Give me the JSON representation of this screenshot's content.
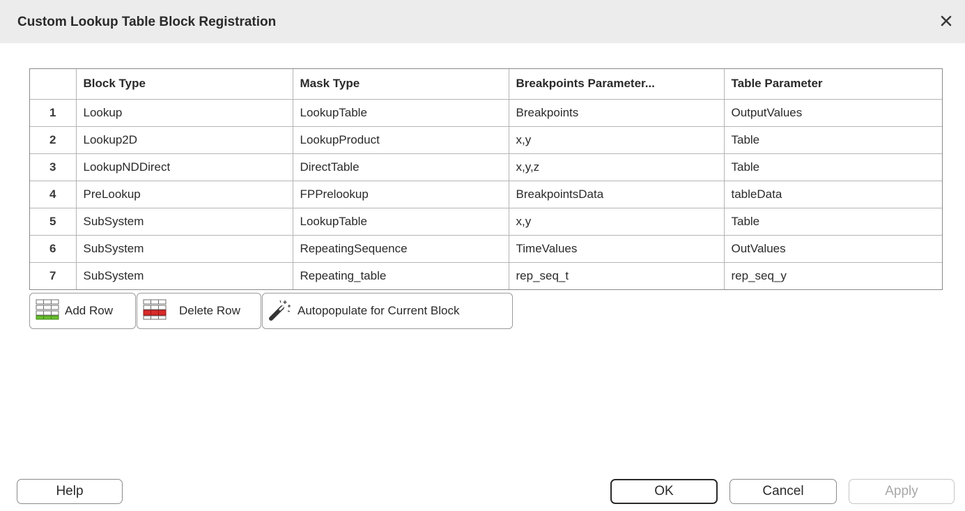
{
  "window": {
    "title": "Custom Lookup Table Block Registration",
    "close_icon": "close-icon"
  },
  "table": {
    "columns": [
      "",
      "Block Type",
      "Mask Type",
      "Breakpoints Parameter...",
      "Table Parameter"
    ],
    "rows": [
      {
        "num": "1",
        "block_type": "Lookup",
        "mask_type": "LookupTable",
        "breakpoints": "Breakpoints",
        "table_param": "OutputValues"
      },
      {
        "num": "2",
        "block_type": "Lookup2D",
        "mask_type": "LookupProduct",
        "breakpoints": "x,y",
        "table_param": "Table"
      },
      {
        "num": "3",
        "block_type": "LookupNDDirect",
        "mask_type": "DirectTable",
        "breakpoints": "x,y,z",
        "table_param": "Table"
      },
      {
        "num": "4",
        "block_type": "PreLookup",
        "mask_type": "FPPrelookup",
        "breakpoints": "BreakpointsData",
        "table_param": "tableData"
      },
      {
        "num": "5",
        "block_type": "SubSystem",
        "mask_type": "LookupTable",
        "breakpoints": "x,y",
        "table_param": "Table"
      },
      {
        "num": "6",
        "block_type": "SubSystem",
        "mask_type": "RepeatingSequence",
        "breakpoints": "TimeValues",
        "table_param": "OutValues"
      },
      {
        "num": "7",
        "block_type": "SubSystem",
        "mask_type": "Repeating_table",
        "breakpoints": "rep_seq_t",
        "table_param": "rep_seq_y"
      }
    ]
  },
  "toolbar": {
    "add_row": {
      "label": "Add Row",
      "icon": "add-row-icon"
    },
    "delete_row": {
      "label": "Delete Row",
      "icon": "delete-row-icon"
    },
    "autopopulate": {
      "label": "Autopopulate for Current Block",
      "icon": "magic-wand-icon"
    }
  },
  "footer": {
    "help": "Help",
    "ok": "OK",
    "cancel": "Cancel",
    "apply": "Apply"
  },
  "colors": {
    "titlebar_bg": "#ececec",
    "add_icon_green": "#6abf2f",
    "delete_icon_red": "#d92b2b",
    "border": "#8a8a8a"
  }
}
